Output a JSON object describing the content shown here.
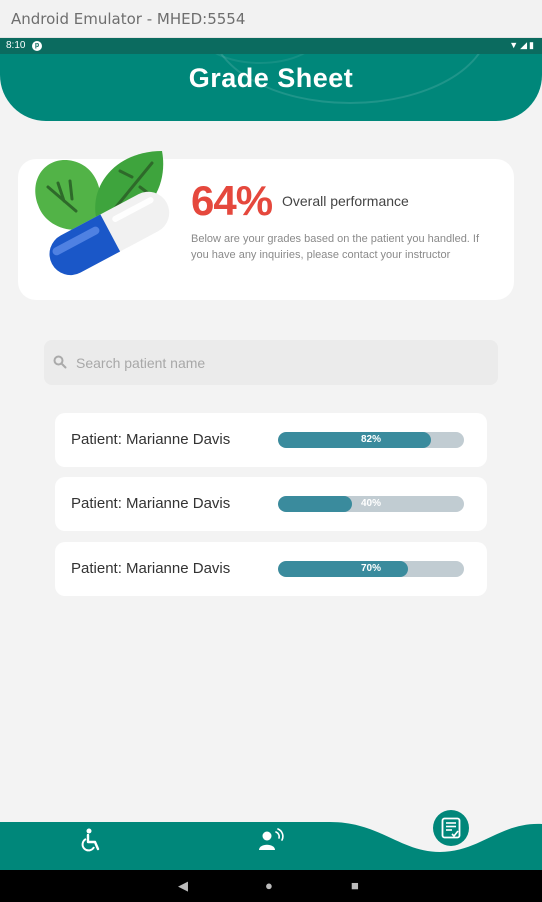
{
  "window": {
    "title": "Android Emulator - MHED:5554"
  },
  "status_bar": {
    "time": "8:10",
    "notification_icon": "app-notification-icon",
    "system_icons": [
      "wifi-icon",
      "signal-icon",
      "battery-icon"
    ]
  },
  "header": {
    "title": "Grade Sheet"
  },
  "performance": {
    "percent": "64%",
    "label": "Overall performance",
    "description": "Below are your grades based on the patient you handled. If you have any inquiries, please contact your instructor",
    "illustration": "pill-with-leaves-illustration"
  },
  "search": {
    "placeholder": "Search patient name",
    "value": ""
  },
  "patients": [
    {
      "name": "Patient: Marianne Davis",
      "grade": 82,
      "grade_label": "82%"
    },
    {
      "name": "Patient: Marianne Davis",
      "grade": 40,
      "grade_label": "40%"
    },
    {
      "name": "Patient: Marianne Davis",
      "grade": 70,
      "grade_label": "70%"
    }
  ],
  "bottom_nav": {
    "items": [
      {
        "icon": "wheelchair-icon"
      },
      {
        "icon": "user-voice-icon"
      },
      {
        "icon": "grade-sheet-icon",
        "active": true
      }
    ]
  },
  "colors": {
    "primary": "#00877a",
    "accent_red": "#e5483d",
    "bar_fill": "#3a8b9d",
    "bar_track": "#c1ccd2"
  }
}
